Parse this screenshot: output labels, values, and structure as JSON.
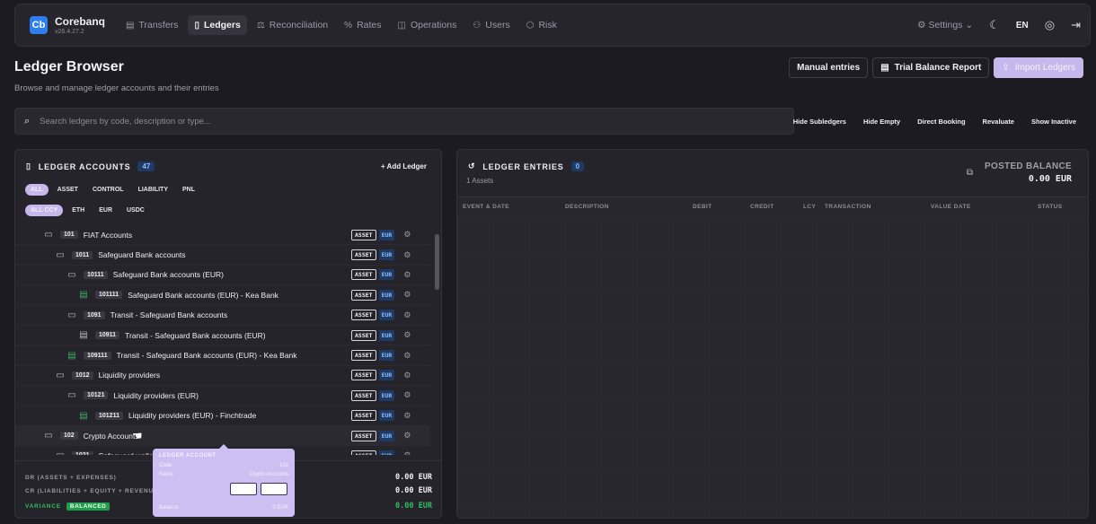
{
  "app": {
    "logo": "Cb",
    "name": "Corebanq",
    "version": "v26.4.27.2"
  },
  "nav": [
    {
      "label": "Transfers",
      "icon": "document-icon",
      "glyph": "▤",
      "active": false
    },
    {
      "label": "Ledgers",
      "icon": "book-icon",
      "glyph": "▯",
      "active": true
    },
    {
      "label": "Reconciliation",
      "icon": "scale-icon",
      "glyph": "⚖",
      "active": false
    },
    {
      "label": "Rates",
      "icon": "percent-icon",
      "glyph": "%",
      "active": false
    },
    {
      "label": "Operations",
      "icon": "briefcase-icon",
      "glyph": "◫",
      "active": false
    },
    {
      "label": "Users",
      "icon": "users-icon",
      "glyph": "⚇",
      "active": false
    },
    {
      "label": "Risk",
      "icon": "shield-icon",
      "glyph": "⬡",
      "active": false
    }
  ],
  "topright": {
    "settings": "Settings",
    "lang": "EN"
  },
  "header": {
    "title": "Ledger Browser",
    "subtitle": "Browse and manage ledger accounts and their entries",
    "manual_entries": "Manual entries",
    "trial_balance": "Trial Balance Report",
    "import_ledgers": "Import Ledgers"
  },
  "search": {
    "placeholder": "Search ledgers by code, description or type..."
  },
  "filters": [
    "Hide Subledgers",
    "Hide Empty",
    "Direct Booking",
    "Revaluate",
    "Show Inactive"
  ],
  "accounts": {
    "title": "LEDGER ACCOUNTS",
    "count": "47",
    "add_label": "+ Add Ledger",
    "type_chips": [
      "ALL",
      "ASSET",
      "CONTROL",
      "LIABILITY",
      "PNL"
    ],
    "ccy_chips": [
      "ALL CCY",
      "ETH",
      "EUR",
      "USDC"
    ],
    "rows": [
      {
        "level": 0,
        "type": "folder",
        "code": "101",
        "name": "FIAT Accounts",
        "kind": "ASSET",
        "ccy": "EUR"
      },
      {
        "level": 1,
        "type": "folder",
        "code": "1011",
        "name": "Safeguard Bank accounts",
        "kind": "ASSET",
        "ccy": "EUR"
      },
      {
        "level": 2,
        "type": "folder",
        "code": "10111",
        "name": "Safeguard Bank accounts (EUR)",
        "kind": "ASSET",
        "ccy": "EUR"
      },
      {
        "level": 3,
        "type": "leaf",
        "code": "101111",
        "name": "Safeguard Bank accounts (EUR) - Kea Bank",
        "kind": "ASSET",
        "ccy": "EUR"
      },
      {
        "level": 2,
        "type": "folder",
        "code": "1091",
        "name": "Transit - Safeguard Bank accounts",
        "kind": "ASSET",
        "ccy": "EUR"
      },
      {
        "level": 3,
        "type": "file",
        "code": "10911",
        "name": "Transit - Safeguard Bank accounts (EUR)",
        "kind": "ASSET",
        "ccy": "EUR"
      },
      {
        "level": 2,
        "type": "leaf",
        "code": "109111",
        "name": "Transit - Safeguard Bank accounts (EUR) - Kea Bank",
        "kind": "ASSET",
        "ccy": "EUR"
      },
      {
        "level": 1,
        "type": "folder",
        "code": "1012",
        "name": "Liquidity providers",
        "kind": "ASSET",
        "ccy": "EUR"
      },
      {
        "level": 2,
        "type": "folder",
        "code": "10121",
        "name": "Liquidity providers (EUR)",
        "kind": "ASSET",
        "ccy": "EUR"
      },
      {
        "level": 3,
        "type": "leaf",
        "code": "101211",
        "name": "Liquidity providers (EUR) - Finchtrade",
        "kind": "ASSET",
        "ccy": "EUR"
      },
      {
        "level": 0,
        "type": "folder",
        "code": "102",
        "name": "Crypto Accounts",
        "kind": "ASSET",
        "ccy": "EUR",
        "highlight": true
      },
      {
        "level": 1,
        "type": "folder",
        "code": "1021",
        "name": "Safeguard walle",
        "kind": "ASSET",
        "ccy": "EUR"
      }
    ],
    "totals": {
      "dr_label": "DR (ASSETS + EXPENSES)",
      "dr_value": "0.00 EUR",
      "cr_label": "CR (LIABILITIES + EQUITY + REVENUE)",
      "cr_value": "0.00 EUR",
      "var_label": "VARIANCE",
      "var_status": "BALANCED",
      "var_value": "0.00 EUR"
    }
  },
  "entries": {
    "title": "LEDGER ENTRIES",
    "count": "0",
    "subtitle": "1 Assets",
    "posted_label": "POSTED BALANCE",
    "posted_value": "0.00 EUR",
    "columns": [
      "EVENT & DATE",
      "DESCRIPTION",
      "DEBIT",
      "CREDIT",
      "LCY",
      "TRANSACTION",
      "VALUE DATE",
      "STATUS"
    ]
  },
  "tooltip": {
    "title": "LEDGER ACCOUNT",
    "code_label": "Code",
    "code_value": "102",
    "name_label": "Name",
    "name_value": "Crypto Accounts",
    "balance_label": "Balance",
    "balance_value": "0 EUR"
  },
  "colors": {
    "accent": "#c6b7ec",
    "brand": "#2d7ff0",
    "success": "#2fbf63",
    "badge": "#1f3a64"
  }
}
